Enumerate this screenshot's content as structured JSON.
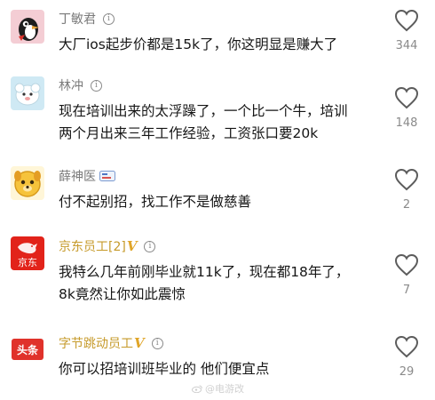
{
  "comments": [
    {
      "username": "丁敏君",
      "text": "大厂ios起步价都是15k了，你这明显是赚大了",
      "likes": "344",
      "avatar_icon": "penguin-avatar-icon"
    },
    {
      "username": "林冲",
      "text": "现在培训出来的太浮躁了，一个比一个牛，培训\n两个月出来三年工作经验，工资张口要20k",
      "likes": "148",
      "avatar_icon": "cartoon-sheep-avatar-icon"
    },
    {
      "username": "薛神医",
      "text": "付不起别招，找工作不是做慈善",
      "likes": "2",
      "avatar_icon": "yellow-dog-avatar-icon"
    },
    {
      "username": "京东员工[2]",
      "text": "我特么几年前刚毕业就11k了，现在都18年了，\n8k竟然让你如此震惊",
      "likes": "7",
      "avatar_icon": "jd-logo-avatar-icon",
      "avatar_text": "京东"
    },
    {
      "username": "字节跳动员工",
      "text": "你可以招培训班毕业的 他们便宜点",
      "likes": "29",
      "avatar_icon": "toutiao-logo-avatar-icon",
      "avatar_text": "头条"
    }
  ],
  "badge_letter": "V",
  "info_glyph": "i",
  "watermark": "@电游改",
  "colors": {
    "text": "#161616",
    "muted": "#8a8a8a",
    "verified_gold": "#e0a528",
    "jd_red": "#e2231a",
    "toutiao_red": "#e0322b"
  }
}
